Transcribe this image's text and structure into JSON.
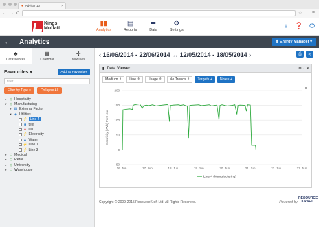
{
  "browser": {
    "tab_title": "Advisor 10"
  },
  "brand": {
    "name_line1": "Kings",
    "name_line2": "Moffatt"
  },
  "nav": [
    {
      "label": "Analytics",
      "icon": "bar-chart-icon",
      "active": true
    },
    {
      "label": "Reports",
      "icon": "document-icon",
      "active": false
    },
    {
      "label": "Data",
      "icon": "database-icon",
      "active": false
    },
    {
      "label": "Settings",
      "icon": "gears-icon",
      "active": false
    }
  ],
  "titlebar": {
    "back": "←",
    "title": "Analytics",
    "energy_manager": "⬆ Energy Manager ▾"
  },
  "sidebar": {
    "tabs": [
      {
        "label": "Datasources",
        "icon": "sitemap-icon"
      },
      {
        "label": "Calendar",
        "icon": "calendar-icon"
      },
      {
        "label": "Modules",
        "icon": "modules-icon"
      }
    ],
    "favourites_label": "Favourites ▾",
    "add_favourites": "Add To Favourites",
    "filter_placeholder": "filter",
    "filter_by_type": "Filter by Type ▾",
    "collapse_all": "Collapse All",
    "tree": [
      {
        "label": "Hospitality",
        "depth": 0,
        "twist": "▸",
        "icon": "◇"
      },
      {
        "label": "Manufacturing",
        "depth": 0,
        "twist": "▾",
        "icon": "◇"
      },
      {
        "label": "External Factor",
        "depth": 1,
        "twist": "▸",
        "icon": "▤"
      },
      {
        "label": "Utilities",
        "depth": 1,
        "twist": "▾",
        "icon": "◈"
      },
      {
        "label": "Line 4",
        "depth": 2,
        "twist": "",
        "icon": "⚡",
        "selected": true,
        "checkbox": true
      },
      {
        "label": "test",
        "depth": 2,
        "twist": "",
        "icon": "■",
        "checkbox": true
      },
      {
        "label": "Oil",
        "depth": 2,
        "twist": "",
        "icon": "●",
        "checkbox": true
      },
      {
        "label": "Electricity",
        "depth": 2,
        "twist": "",
        "icon": "⚡",
        "checkbox": true
      },
      {
        "label": "Water",
        "depth": 2,
        "twist": "",
        "icon": "▲",
        "checkbox": true
      },
      {
        "label": "Line 1",
        "depth": 2,
        "twist": "",
        "icon": "⚡",
        "checkbox": true
      },
      {
        "label": "Line 3",
        "depth": 2,
        "twist": "",
        "icon": "⚡",
        "checkbox": true
      },
      {
        "label": "Medical",
        "depth": 0,
        "twist": "▸",
        "icon": "◇"
      },
      {
        "label": "Retail",
        "depth": 0,
        "twist": "▸",
        "icon": "◇"
      },
      {
        "label": "University",
        "depth": 0,
        "twist": "▸",
        "icon": "◇"
      },
      {
        "label": "Warehouse",
        "depth": 0,
        "twist": "▸",
        "icon": "◇"
      }
    ]
  },
  "main": {
    "date_range": "‹  16/06/2014 - 22/06/2014 ↔ 12/05/2014 - 18/05/2014  ›",
    "panel_title": "Data Viewer",
    "panel_tools": "⚙ ↔ ▾",
    "controls": {
      "resolution": "Medium ⇕",
      "chart_type": "Line ⇕",
      "measure": "Usage ⇕",
      "trends": "No Trends ⇕",
      "targets": "Targets  +",
      "notes": "Notes  +"
    },
    "footer": "Copyright © 2009-2015 ResourceKraft Ltd. All Rights Reserved.",
    "powered_by": "Powered by:",
    "powered_logo": "RESOURCE KRAFT"
  },
  "colors": {
    "accent_orange": "#f0763b",
    "primary_blue": "#1f73c4",
    "series": "#2eaa3e",
    "header_dark": "#3e4650"
  },
  "chart_data": {
    "type": "line",
    "title": "",
    "ylabel": "Electricity (kWh) Per Hour",
    "ylim": [
      -50,
      200
    ],
    "yticks": [
      -50,
      0,
      50,
      100,
      150,
      200
    ],
    "x_ticks": [
      "16. Jun",
      "17. Jun",
      "18. Jun",
      "19. Jun",
      "20. Jun",
      "21. Jun",
      "22. Jun",
      "23. Jun"
    ],
    "xlim": [
      0,
      7
    ],
    "legend": "Line 4 (Manufacturing)",
    "series": [
      {
        "name": "Line 4 (Manufacturing)",
        "points": [
          [
            0.0,
            0
          ],
          [
            0.03,
            0
          ],
          [
            0.05,
            135
          ],
          [
            0.3,
            138
          ],
          [
            0.42,
            136
          ],
          [
            0.44,
            150
          ],
          [
            0.5,
            152
          ],
          [
            0.7,
            155
          ],
          [
            0.8,
            140
          ],
          [
            0.85,
            148
          ],
          [
            0.95,
            151
          ],
          [
            1.05,
            149
          ],
          [
            1.2,
            152
          ],
          [
            1.35,
            148
          ],
          [
            1.5,
            150
          ],
          [
            1.7,
            152
          ],
          [
            1.8,
            153
          ],
          [
            1.86,
            95
          ],
          [
            1.9,
            150
          ],
          [
            2.0,
            151
          ],
          [
            2.2,
            152
          ],
          [
            2.3,
            150
          ],
          [
            2.4,
            152
          ],
          [
            2.55,
            147
          ],
          [
            2.6,
            40
          ],
          [
            2.65,
            150
          ],
          [
            2.8,
            151
          ],
          [
            3.0,
            152
          ],
          [
            3.1,
            149
          ],
          [
            3.2,
            150
          ],
          [
            3.4,
            152
          ],
          [
            3.5,
            148
          ],
          [
            3.62,
            150
          ],
          [
            3.7,
            151
          ],
          [
            3.78,
            100
          ],
          [
            3.82,
            150
          ],
          [
            3.9,
            152
          ],
          [
            4.0,
            150
          ],
          [
            4.1,
            148
          ],
          [
            4.3,
            150
          ],
          [
            4.4,
            152
          ],
          [
            4.48,
            120
          ],
          [
            4.52,
            150
          ],
          [
            4.6,
            151
          ],
          [
            4.8,
            150
          ],
          [
            4.85,
            130
          ],
          [
            4.9,
            152
          ],
          [
            5.0,
            151
          ],
          [
            5.05,
            15
          ],
          [
            5.12,
            15
          ],
          [
            5.2,
            15
          ],
          [
            5.22,
            0
          ],
          [
            6.98,
            0
          ],
          [
            7.0,
            0
          ]
        ]
      }
    ]
  }
}
